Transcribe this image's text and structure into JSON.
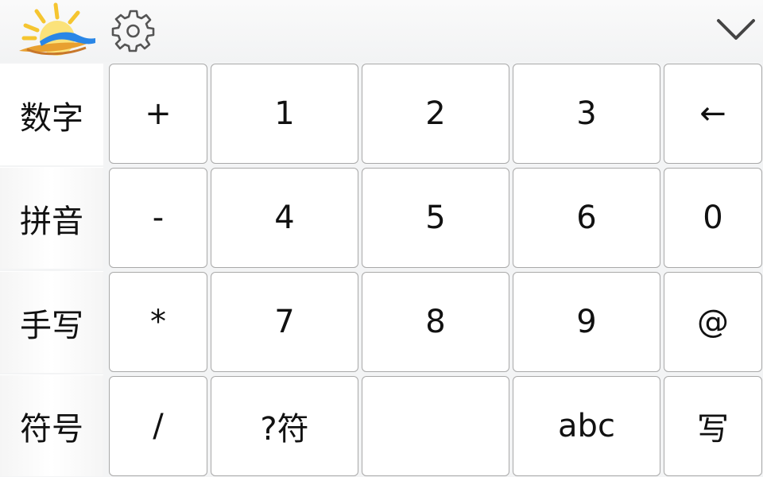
{
  "toolbar": {
    "logo_icon": "sun-over-cloud-logo",
    "settings_icon": "gear-icon",
    "collapse_icon": "chevron-down-icon"
  },
  "sidebar": {
    "items": [
      {
        "label": "数字",
        "active": true
      },
      {
        "label": "拼音",
        "active": false
      },
      {
        "label": "手写",
        "active": false
      },
      {
        "label": "符号",
        "active": false
      }
    ]
  },
  "keypad": {
    "rows": [
      [
        "+",
        "1",
        "2",
        "3",
        "←"
      ],
      [
        "-",
        "4",
        "5",
        "6",
        "0"
      ],
      [
        "*",
        "7",
        "8",
        "9",
        "@"
      ],
      [
        "/",
        "?符",
        "",
        "abc",
        "写"
      ]
    ]
  },
  "colors": {
    "key_background": "#ffffff",
    "key_border": "#a9a9a9",
    "panel_background": "#f3f4f5",
    "logo_sun": "#f5c530",
    "logo_wave": "#2a86e6",
    "logo_orange": "#e8a030"
  }
}
